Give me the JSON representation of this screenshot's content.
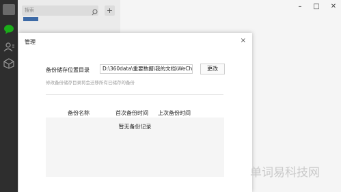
{
  "search": {
    "placeholder": "搜索"
  },
  "add_button": "+",
  "window": {
    "minimize": "–",
    "maximize": "□",
    "close": "✕"
  },
  "dialog": {
    "title": "管理",
    "close": "×",
    "storage_label": "备份储存位置目录",
    "storage_path": "D:\\360data\\重要数据\\我的文档\\WeCha",
    "change_button": "更改",
    "hint": "修改备份储存目录将会迁移所有已储存的备份",
    "columns": [
      "备份名称",
      "首次备份时间",
      "上次备份时间"
    ],
    "empty_text": "暂无备份记录"
  },
  "watermark": "单词易科技网",
  "colors": {
    "nav_bg": "#2e2e2e",
    "chat_active": "#1aad19",
    "accent_strip": "#3d6aa6"
  }
}
